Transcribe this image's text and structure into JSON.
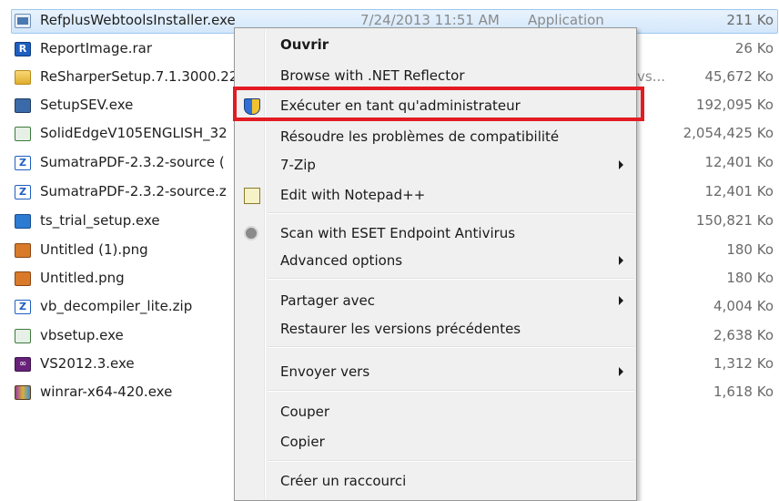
{
  "files": [
    {
      "name": "RefplusWebtoolsInstaller.exe",
      "date": "7/24/2013 11:51 AM",
      "type": "Application",
      "extra": "",
      "size": "211 Ko",
      "icon": "exe-icon",
      "selected": true
    },
    {
      "name": "ReportImage.rar",
      "date": "",
      "type": "",
      "extra": "",
      "size": "26 Ko",
      "icon": "rar-icon"
    },
    {
      "name": "ReSharperSetup.7.1.3000.22",
      "date": "",
      "type": "",
      "extra": "vs...",
      "size": "45,672 Ko",
      "icon": "folder-icon"
    },
    {
      "name": "SetupSEV.exe",
      "date": "",
      "type": "",
      "extra": "",
      "size": "192,095 Ko",
      "icon": "sev-icon"
    },
    {
      "name": "SolidEdgeV105ENGLISH_32",
      "date": "",
      "type": "",
      "extra": "",
      "size": "2,054,425 Ko",
      "icon": "setup-icon"
    },
    {
      "name": "SumatraPDF-2.3.2-source (",
      "date": "",
      "type": "",
      "extra": "",
      "size": "12,401 Ko",
      "icon": "zip-icon"
    },
    {
      "name": "SumatraPDF-2.3.2-source.z",
      "date": "",
      "type": "",
      "extra": "",
      "size": "12,401 Ko",
      "icon": "zip-icon"
    },
    {
      "name": "ts_trial_setup.exe",
      "date": "",
      "type": "",
      "extra": "",
      "size": "150,821 Ko",
      "icon": "ts-icon"
    },
    {
      "name": "Untitled (1).png",
      "date": "",
      "type": "",
      "extra": "",
      "size": "180 Ko",
      "icon": "png-icon"
    },
    {
      "name": "Untitled.png",
      "date": "",
      "type": "",
      "extra": "",
      "size": "180 Ko",
      "icon": "png-icon"
    },
    {
      "name": "vb_decompiler_lite.zip",
      "date": "",
      "type": "",
      "extra": "",
      "size": "4,004 Ko",
      "icon": "zip-icon"
    },
    {
      "name": "vbsetup.exe",
      "date": "",
      "type": "",
      "extra": "",
      "size": "2,638 Ko",
      "icon": "setup-icon"
    },
    {
      "name": "VS2012.3.exe",
      "date": "",
      "type": "",
      "extra": "",
      "size": "1,312 Ko",
      "icon": "vs-icon"
    },
    {
      "name": "winrar-x64-420.exe",
      "date": "",
      "type": "",
      "extra": "",
      "size": "1,618 Ko",
      "icon": "winrar-icon"
    }
  ],
  "context_menu": {
    "items": [
      {
        "label": "Ouvrir",
        "bold": true,
        "icon": "",
        "submenu": false
      },
      {
        "label": "Browse with .NET Reflector",
        "icon": "",
        "submenu": false
      },
      {
        "label": "Exécuter en tant qu'administrateur",
        "icon": "shield-icon",
        "submenu": false,
        "highlighted": true
      },
      {
        "label": "Résoudre les problèmes de compatibilité",
        "icon": "",
        "submenu": false
      },
      {
        "label": "7-Zip",
        "icon": "",
        "submenu": true
      },
      {
        "label": "Edit with Notepad++",
        "icon": "notepad-icon",
        "submenu": false
      },
      {
        "label": "Scan with ESET Endpoint Antivirus",
        "icon": "eset-icon",
        "submenu": false
      },
      {
        "label": "Advanced options",
        "icon": "",
        "submenu": true
      },
      {
        "label": "Partager avec",
        "icon": "",
        "submenu": true
      },
      {
        "label": "Restaurer les versions précédentes",
        "icon": "",
        "submenu": false
      },
      {
        "label": "Envoyer vers",
        "icon": "",
        "submenu": true
      },
      {
        "label": "Couper",
        "icon": "",
        "submenu": false
      },
      {
        "label": "Copier",
        "icon": "",
        "submenu": false
      },
      {
        "label": "Créer un raccourci",
        "icon": "",
        "submenu": false
      }
    ]
  },
  "colors": {
    "highlight_border": "#e31b23",
    "selection_bg": "#d3e7fb",
    "menu_bg": "#f0f0f0"
  }
}
